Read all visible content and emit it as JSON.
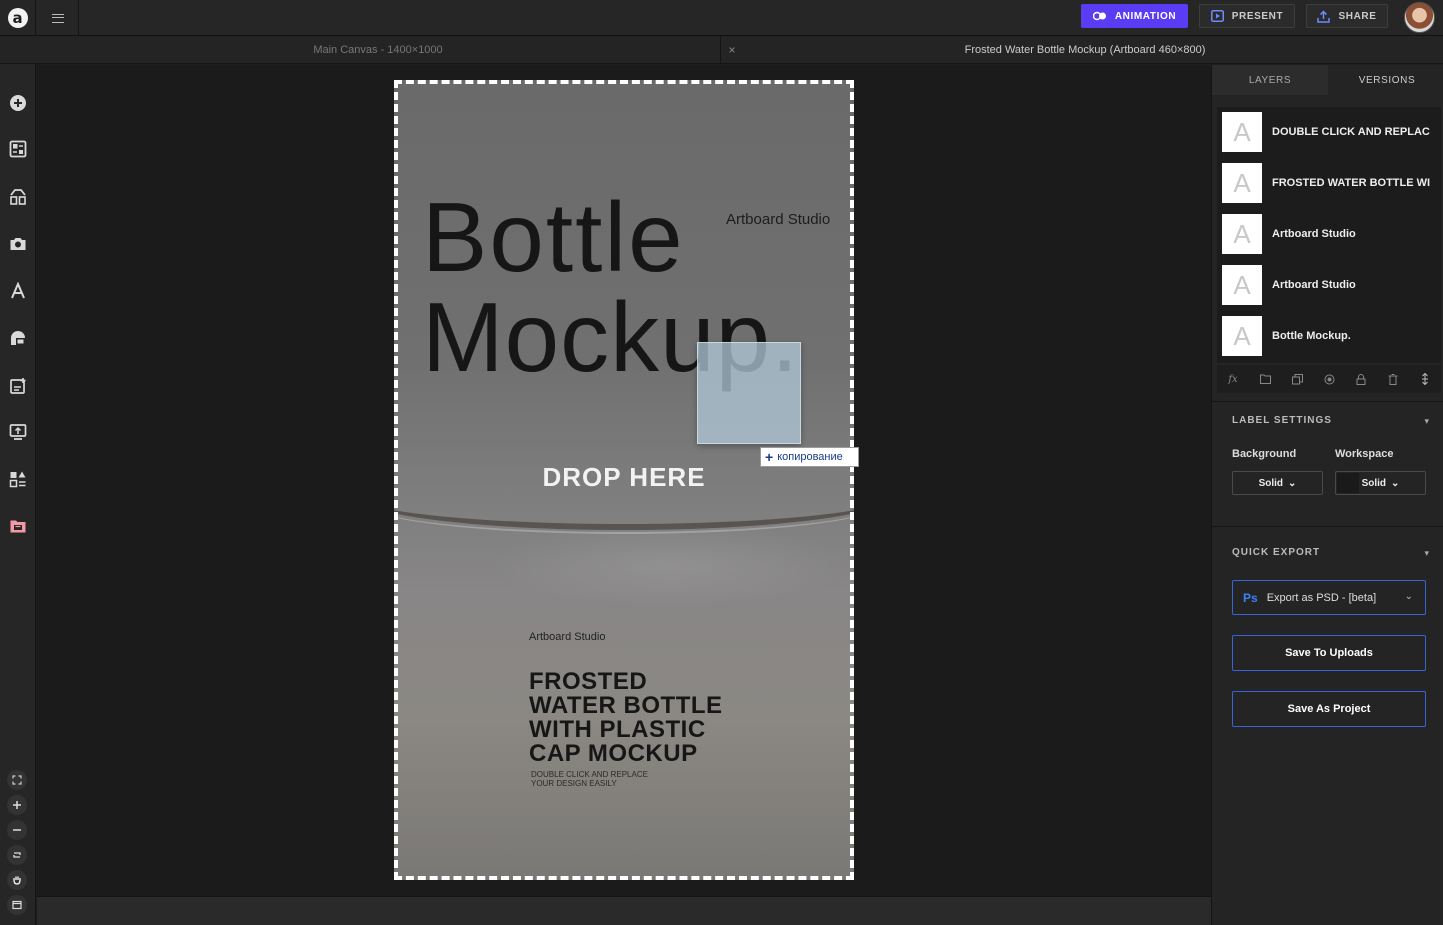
{
  "topbar": {
    "logo_letter": "a",
    "animation_label": "ANIMATION",
    "present_label": "PRESENT",
    "share_label": "SHARE"
  },
  "tabs": {
    "tab1_label": "Main Canvas - 1400×1000",
    "close_glyph": "×",
    "tab2_label": "Frosted Water Bottle Mockup (Artboard 460×800)"
  },
  "left_tools": [
    "add-icon",
    "templates-icon",
    "elements-icon",
    "photo-icon",
    "text-icon",
    "shapes-icon",
    "uploads-icon",
    "present-icon",
    "layout-icon",
    "projects-icon"
  ],
  "zoom_tools": [
    "fit-icon",
    "zoom-in-icon",
    "zoom-out-icon",
    "reset-zoom-icon",
    "hand-icon",
    "window-icon"
  ],
  "artboard": {
    "title_line1": "Bottle",
    "title_line2": "Mockup.",
    "studio_top": "Artboard Studio",
    "drop_text": "DROP HERE",
    "studio_bottom": "Artboard Studio",
    "frosted_lines": [
      "FROSTED",
      "WATER BOTTLE",
      "WITH PLASTIC",
      "CAP MOCKUP"
    ],
    "small_lines": [
      "DOUBLE CLICK AND REPLACE",
      "YOUR DESIGN EASILY"
    ],
    "copy_tooltip": "копирование"
  },
  "panel": {
    "tab_layers": "LAYERS",
    "tab_versions": "VERSIONS",
    "layers": [
      {
        "thumb": "A",
        "name": "DOUBLE CLICK AND REPLAC"
      },
      {
        "thumb": "A",
        "name": "FROSTED WATER BOTTLE WI"
      },
      {
        "thumb": "A",
        "name": "Artboard Studio"
      },
      {
        "thumb": "A",
        "name": "Artboard Studio"
      },
      {
        "thumb": "A",
        "name": "Bottle Mockup."
      }
    ],
    "layer_actions": [
      "fx-icon",
      "folder-icon",
      "duplicate-icon",
      "visibility-icon",
      "lock-icon",
      "trash-icon",
      "expand-icon"
    ],
    "label_settings": {
      "heading": "LABEL SETTINGS",
      "background_label": "Background",
      "workspace_label": "Workspace",
      "background_value": "Solid",
      "workspace_value": "Solid"
    },
    "quick_export": {
      "heading": "QUICK EXPORT",
      "format_icon_text": "Ps",
      "format_value": "Export as PSD - [beta]",
      "save_uploads": "Save To Uploads",
      "save_project": "Save As Project"
    }
  },
  "colors": {
    "accent": "#5b3cf5",
    "export_border": "#3a63d8",
    "panel_bg": "#242424"
  }
}
